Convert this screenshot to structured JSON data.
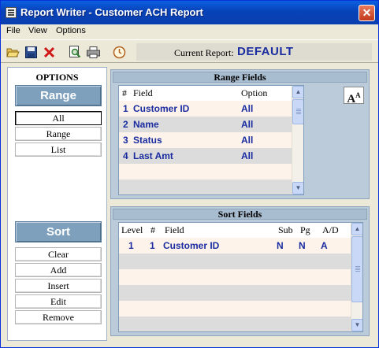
{
  "window": {
    "title": "Report Writer - Customer ACH Report"
  },
  "menu": [
    "File",
    "View",
    "Options"
  ],
  "toolbar": {
    "buttons": [
      "open-folder-icon",
      "save-icon",
      "delete-icon",
      "print-preview-icon",
      "print-icon",
      "schedule-icon"
    ],
    "current_report_label": "Current Report:",
    "current_report_value": "DEFAULT"
  },
  "options": {
    "heading": "OPTIONS",
    "range_label": "Range",
    "range_buttons": [
      "All",
      "Range",
      "List"
    ],
    "range_selected": "All",
    "sort_label": "Sort",
    "sort_buttons": [
      "Clear",
      "Add",
      "Insert",
      "Edit",
      "Remove"
    ]
  },
  "range_fields": {
    "title": "Range  Fields",
    "headers": [
      "#",
      "Field",
      "Option"
    ],
    "rows": [
      {
        "num": "1",
        "field": "Customer ID",
        "option": "All"
      },
      {
        "num": "2",
        "field": "Name",
        "option": "All"
      },
      {
        "num": "3",
        "field": "Status",
        "option": "All"
      },
      {
        "num": "4",
        "field": "Last Amt",
        "option": "All"
      }
    ]
  },
  "sort_fields": {
    "title": "Sort Fields",
    "headers": [
      "Level",
      "#",
      "Field",
      "Sub",
      "Pg",
      "A/D"
    ],
    "rows": [
      {
        "level": "1",
        "num": "1",
        "field": "Customer ID",
        "sub": "N",
        "pg": "N",
        "ad": "A"
      }
    ]
  },
  "colors": {
    "accent": "#1a2ca0",
    "title_bar": "#0842b8",
    "section_button": "#7ea0bd"
  }
}
